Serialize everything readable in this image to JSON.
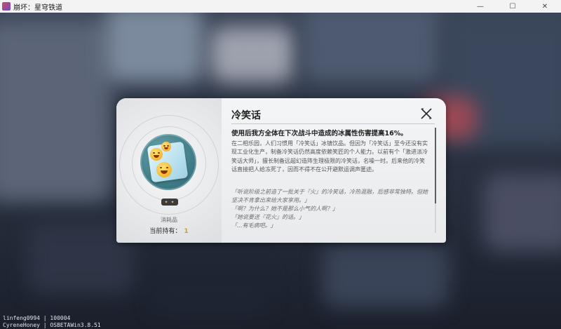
{
  "window": {
    "title": "崩坏：星穹铁道",
    "controls": {
      "minimize": "—",
      "maximize": "☐",
      "close": "✕"
    }
  },
  "build_info": {
    "line1": "linfeng0994 | 100004",
    "line2": "CyreneHoney | OSBETAWin3.8.51"
  },
  "item": {
    "name": "冷笑话",
    "effect": "使用后我方全体在下次战斗中造成的冰属性伤害提高16%。",
    "description": "在二相乐园，人们习惯用「冷笑话」冰镇饮品。但因为「冷笑话」至今还没有实现工业化生产，制备冷笑话仍然高度依赖笑匠的个人能力。以前有个「激进派冷笑话大师」，擅长制备远超幻造阵生理极限的冷笑话，名噪一时。后来他的冷笑话直接把人给冻死了，因而不得不在公开避默运调声匿迹。",
    "quote_lines": [
      "「听说阶级之前造了一批关于『火』的冷笑话，冷热混融，后感非常独特。但她坚决不肯拿出来给大家享用。」",
      "「啊？为什么？她不是那么小气的人啊？」",
      "「她说要送『花火』的话。」",
      "「...有毛病吧。」"
    ],
    "rarity": "✦ ✦",
    "type": "消耗品",
    "owned_label": "当前持有：",
    "owned_count": "1",
    "icon": "ice-cube-with-smiley-faces-icon"
  },
  "colors": {
    "accent_gold": "#d99a25",
    "dialog_bg": "#f0f1f2"
  }
}
